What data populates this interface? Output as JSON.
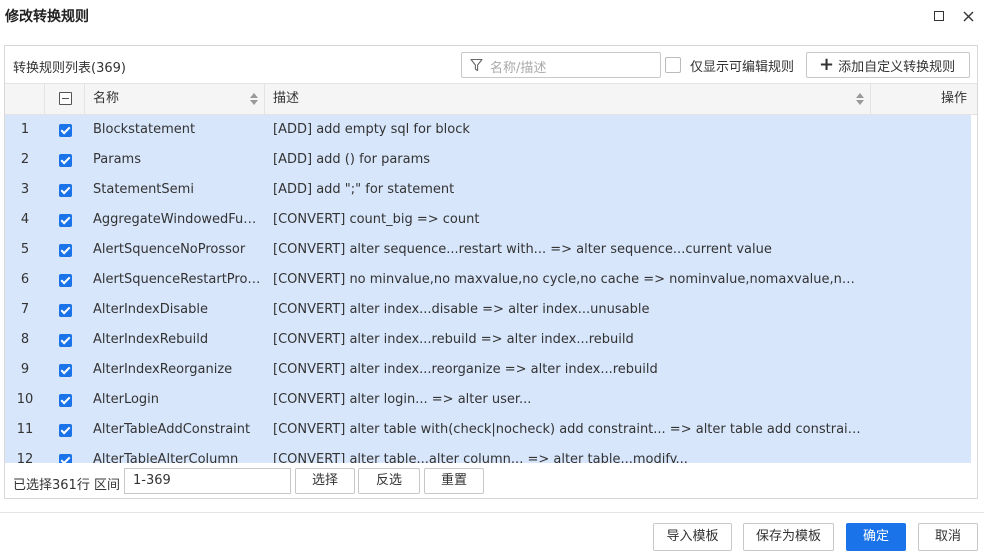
{
  "dialog": {
    "title": "修改转换规则"
  },
  "toolbar": {
    "list_title": "转换规则列表(369)",
    "search_placeholder": "名称/描述",
    "only_editable_label": "仅显示可编辑规则",
    "add_rule_label": "添加自定义转换规则"
  },
  "table": {
    "columns": {
      "name": "名称",
      "description": "描述",
      "operation": "操作"
    },
    "rows": [
      {
        "num": "1",
        "name": "Blockstatement",
        "desc": "[ADD] add empty sql for block",
        "checked": true
      },
      {
        "num": "2",
        "name": "Params",
        "desc": "[ADD] add () for params",
        "checked": true
      },
      {
        "num": "3",
        "name": "StatementSemi",
        "desc": "[ADD] add \";\" for statement",
        "checked": true
      },
      {
        "num": "4",
        "name": "AggregateWindowedFunc...",
        "desc": "[CONVERT] count_big => count",
        "checked": true
      },
      {
        "num": "5",
        "name": "AlertSquenceNoProssor",
        "desc": "[CONVERT] alter sequence...restart with... => alter sequence...current value",
        "checked": true
      },
      {
        "num": "6",
        "name": "AlertSquenceRestartPros...",
        "desc": "[CONVERT] no minvalue,no maxvalue,no cycle,no cache => nominvalue,nomaxvalue,nocycle,noca...",
        "checked": true
      },
      {
        "num": "7",
        "name": "AlterIndexDisable",
        "desc": "[CONVERT] alter index...disable => alter index...unusable",
        "checked": true
      },
      {
        "num": "8",
        "name": "AlterIndexRebuild",
        "desc": "[CONVERT] alter index...rebuild => alter index...rebuild",
        "checked": true
      },
      {
        "num": "9",
        "name": "AlterIndexReorganize",
        "desc": "[CONVERT] alter index...reorganize => alter index...rebuild",
        "checked": true
      },
      {
        "num": "10",
        "name": "AlterLogin",
        "desc": "[CONVERT] alter login... => alter user...",
        "checked": true
      },
      {
        "num": "11",
        "name": "AlterTableAddConstraint",
        "desc": "[CONVERT] alter table with(check|nocheck) add constraint... => alter table add constraint...validate|...",
        "checked": true
      },
      {
        "num": "12",
        "name": "AlterTableAlterColumn",
        "desc": "[CONVERT] alter table...alter column... => alter table...modify...",
        "checked": true
      }
    ]
  },
  "footer": {
    "selection_text": "已选择361行 区间",
    "range_value": "1-369",
    "select_label": "选择",
    "invert_label": "反选",
    "reset_label": "重置"
  },
  "actions": {
    "import_label": "导入模板",
    "save_template_label": "保存为模板",
    "ok_label": "确定",
    "cancel_label": "取消"
  },
  "colors": {
    "primary": "#1a73e8",
    "row_selected": "#d7e6fb",
    "header_bg": "#f5f5f5"
  }
}
